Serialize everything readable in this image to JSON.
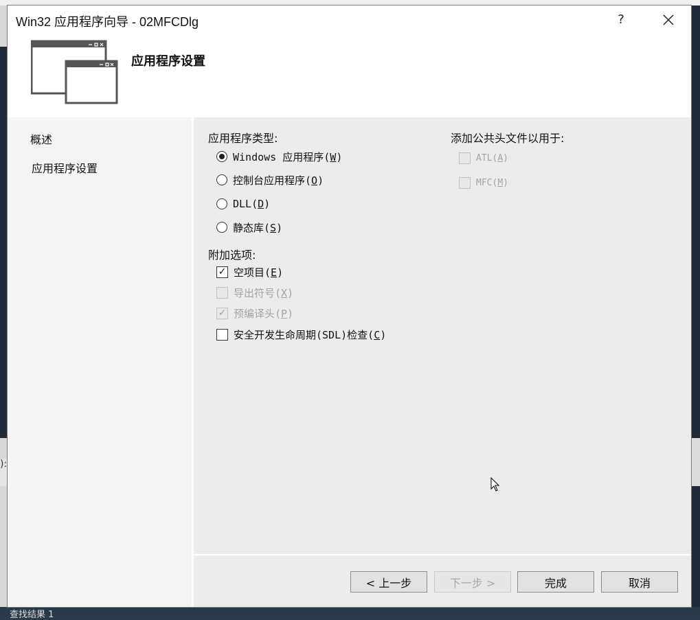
{
  "window": {
    "title": "Win32 应用程序向导 - 02MFCDlg",
    "help_label": "?",
    "header_title": "应用程序设置"
  },
  "nav": {
    "items": [
      {
        "label": "概述"
      },
      {
        "label": "应用程序设置"
      }
    ]
  },
  "app_type": {
    "group_label": "应用程序类型:",
    "options": [
      {
        "label": "Windows 应用程序(",
        "key": "W",
        "end": ")",
        "checked": true
      },
      {
        "label": "控制台应用程序(",
        "key": "O",
        "end": ")",
        "checked": false
      },
      {
        "label": "DLL(",
        "key": "D",
        "end": ")",
        "checked": false
      },
      {
        "label": "静态库(",
        "key": "S",
        "end": ")",
        "checked": false
      }
    ]
  },
  "extra_options": {
    "group_label": "附加选项:",
    "options": [
      {
        "label": "空项目(",
        "key": "E",
        "end": ")",
        "checked": true,
        "enabled": true
      },
      {
        "label": "导出符号(",
        "key": "X",
        "end": ")",
        "checked": false,
        "enabled": false
      },
      {
        "label": "预编译头(",
        "key": "P",
        "end": ")",
        "checked": true,
        "enabled": false
      },
      {
        "label": "安全开发生命周期(SDL)检查(",
        "key": "C",
        "end": ")",
        "checked": false,
        "enabled": true
      }
    ]
  },
  "common_headers": {
    "group_label": "添加公共头文件以用于:",
    "options": [
      {
        "label": "ATL(",
        "key": "A",
        "end": ")",
        "checked": false,
        "enabled": false
      },
      {
        "label": "MFC(",
        "key": "M",
        "end": ")",
        "checked": false,
        "enabled": false
      }
    ]
  },
  "buttons": {
    "prev": "< 上一步",
    "next": "下一步 >",
    "finish": "完成",
    "cancel": "取消"
  },
  "background": {
    "left_mark": "):",
    "bottom_text": "查找结果 1"
  }
}
